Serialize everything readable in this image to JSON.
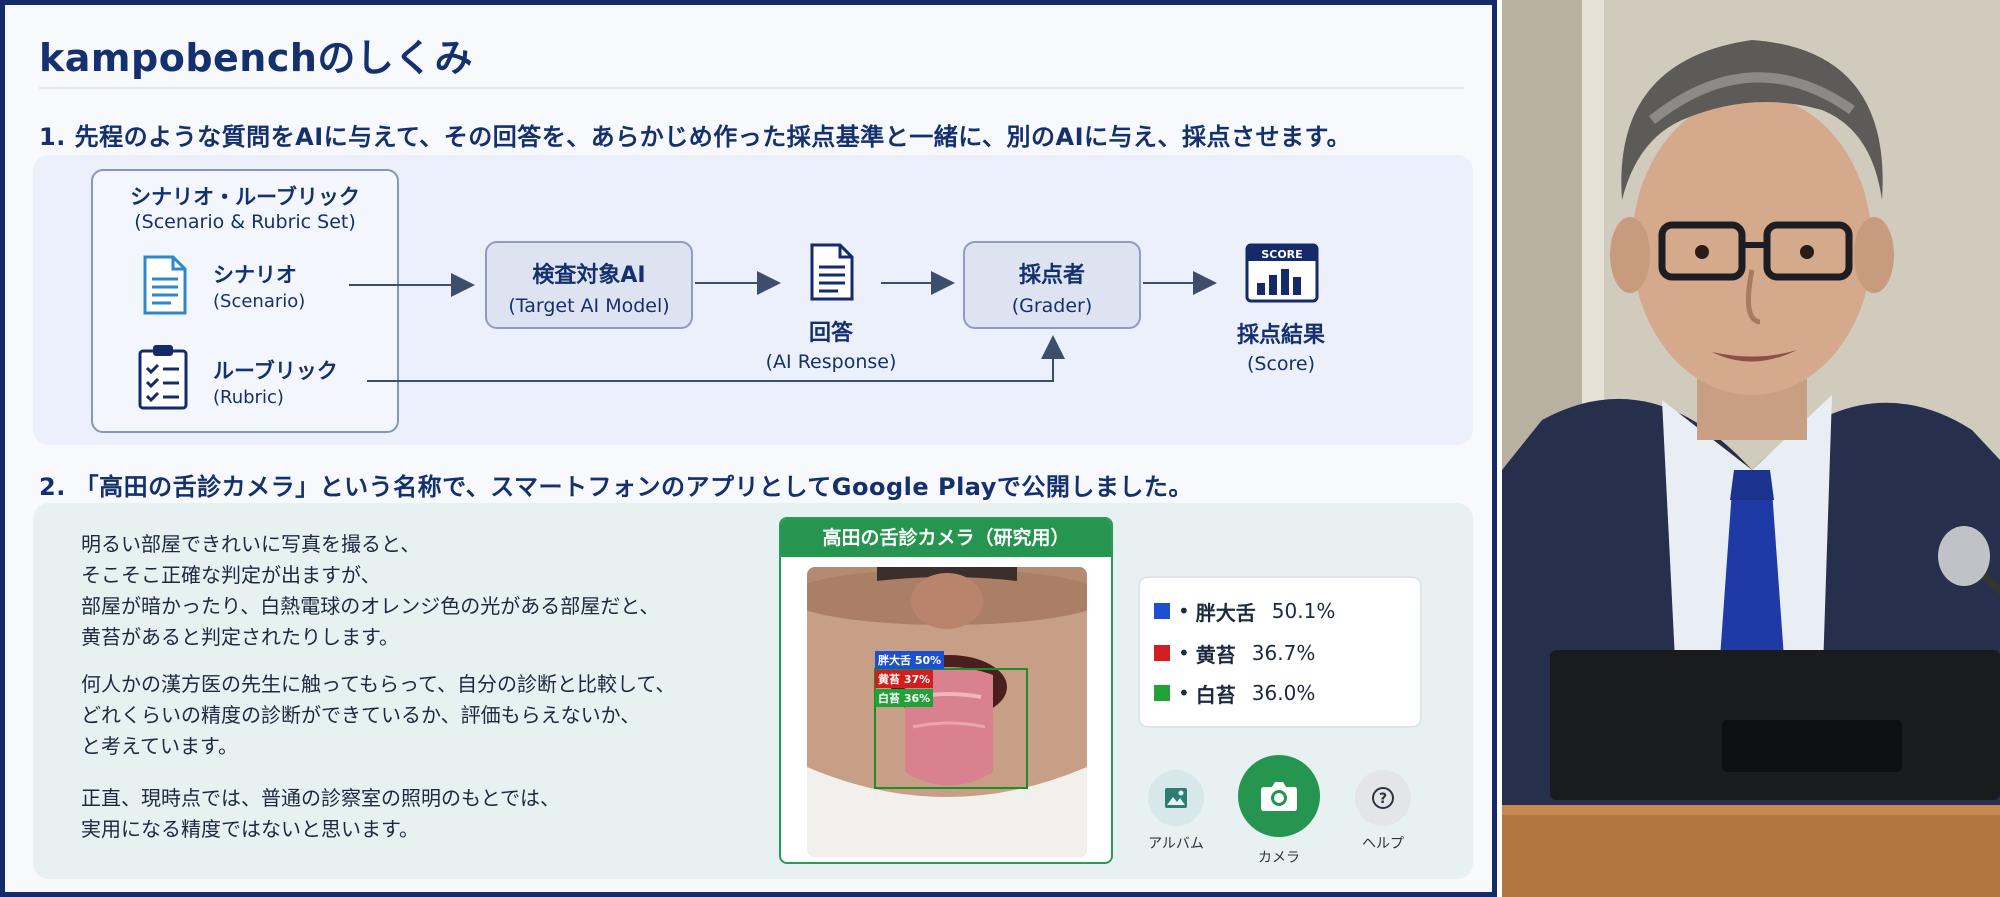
{
  "slide": {
    "title": "kampobenchのしくみ",
    "section1": "1.  先程のような質問をAIに与えて、その回答を、あらかじめ作った採点基準と一緒に、別のAIに与え、採点させます。",
    "section2": "2.  「高田の舌診カメラ」という名称で、スマートフォンのアプリとしてGoogle Playで公開しました。"
  },
  "diagram": {
    "set_title": "シナリオ・ルーブリック",
    "set_subtitle": "(Scenario & Rubric Set)",
    "scenario_label": "シナリオ",
    "scenario_sub": "(Scenario)",
    "rubric_label": "ルーブリック",
    "rubric_sub": "(Rubric)",
    "target_label": "検査対象AI",
    "target_sub": "(Target AI Model)",
    "response_label": "回答",
    "response_sub": "(AI Response)",
    "grader_label": "採点者",
    "grader_sub": "(Grader)",
    "score_icon_text": "SCORE",
    "score_label": "採点結果",
    "score_sub": "(Score)",
    "icons": [
      "document-icon",
      "clipboard-checklist-icon",
      "response-document-icon",
      "score-chart-icon"
    ]
  },
  "description": {
    "para1": [
      "明るい部屋できれいに写真を撮ると、",
      "そこそこ正確な判定が出ますが、",
      "部屋が暗かったり、白熱電球のオレンジ色の光がある部屋だと、",
      "黄苔があると判定されたりします。"
    ],
    "para2": [
      "何人かの漢方医の先生に触ってもらって、自分の診断と比較して、",
      "どれくらいの精度の診断ができているか、評価もらえないか、",
      "と考えています。"
    ],
    "para3": [
      "正直、現時点では、普通の診察室の照明のもとでは、",
      "実用になる精度ではないと思います。"
    ]
  },
  "app": {
    "header": "高田の舌診カメラ（研究用）",
    "tags": [
      "胖大舌 50%",
      "黄苔 37%",
      "白苔 36%"
    ],
    "results": [
      {
        "name": "胖大舌",
        "value": "50.1%",
        "color": "#1f4fd1"
      },
      {
        "name": "黄苔",
        "value": "36.7%",
        "color": "#d11f1f"
      },
      {
        "name": "白苔",
        "value": "36.0%",
        "color": "#21a136"
      }
    ],
    "bullet": "•",
    "album_label": "アルバム",
    "camera_label": "カメラ",
    "help_label": "ヘルプ",
    "accent": "#25954f"
  }
}
